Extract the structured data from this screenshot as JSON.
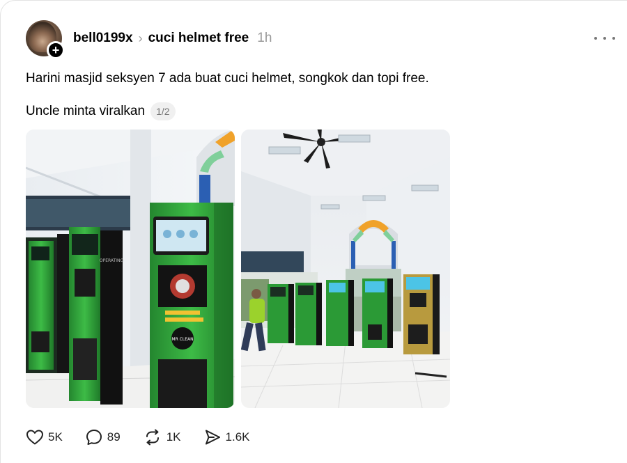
{
  "post": {
    "username": "bell0199x",
    "separator": "›",
    "topic": "cuci helmet free",
    "time": "1h",
    "text_line1": "Harini masjid seksyen 7 ada buat cuci helmet, songkok dan topi free.",
    "text_line2": "Uncle minta viralkan",
    "pager": "1/2"
  },
  "actions": {
    "like_count": "5K",
    "comment_count": "89",
    "repost_count": "1K",
    "share_count": "1.6K"
  },
  "icons": {
    "avatar_badge": "plus-icon",
    "more": "more-dots-icon",
    "like": "heart-icon",
    "comment": "comment-bubble-icon",
    "repost": "repost-icon",
    "share": "send-icon"
  },
  "colors": {
    "text": "#000000",
    "muted": "#999999",
    "kiosk_green": "#2f9e3a"
  }
}
